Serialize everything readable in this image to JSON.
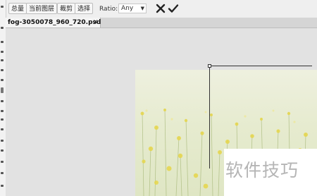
{
  "toolbar": {
    "buttons": [
      "总量",
      "当前图层",
      "裁剪",
      "选择"
    ],
    "ratio_label": "Ratio:",
    "ratio_value": "Any",
    "cancel_icon": "x-icon",
    "confirm_icon": "checkmark-icon"
  },
  "document_tab": {
    "filename": "fog-3050078_960_720.psd",
    "close_label": "✕"
  },
  "watermark": {
    "text": "软件技巧"
  },
  "colors": {
    "canvas_bg": "#e2e2e2",
    "flower_yellow": "#e8d94a",
    "stem_green": "#9fb36a"
  }
}
